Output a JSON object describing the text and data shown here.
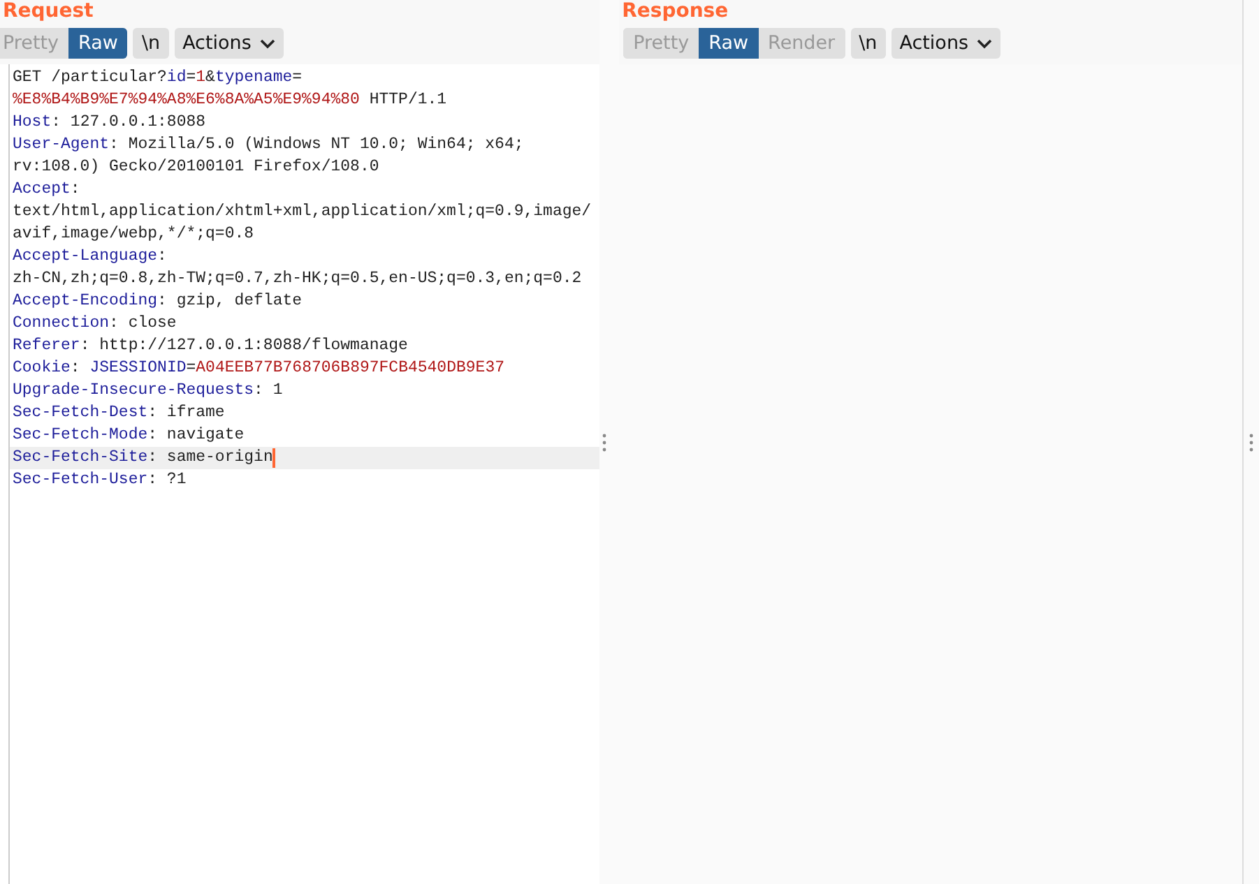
{
  "panels": [
    {
      "title": "Request",
      "view_modes": [
        {
          "label": "Pretty",
          "selected": false
        },
        {
          "label": "Raw",
          "selected": true
        }
      ],
      "newline_button": "\\n",
      "actions_button": "Actions",
      "lines": [
        {
          "highlighted": false,
          "segments": [
            {
              "kind": "plain",
              "text": "GET /particular?"
            },
            {
              "kind": "key",
              "text": "id"
            },
            {
              "kind": "plain",
              "text": "="
            },
            {
              "kind": "value",
              "text": "1"
            },
            {
              "kind": "plain",
              "text": "&"
            },
            {
              "kind": "key",
              "text": "typename"
            },
            {
              "kind": "plain",
              "text": "="
            }
          ]
        },
        {
          "highlighted": false,
          "segments": [
            {
              "kind": "value",
              "text": "%E8%B4%B9%E7%94%A8%E6%8A%A5%E9%94%80"
            },
            {
              "kind": "plain",
              "text": " HTTP/1.1"
            }
          ]
        },
        {
          "highlighted": false,
          "segments": [
            {
              "kind": "key",
              "text": "Host"
            },
            {
              "kind": "plain",
              "text": ": 127.0.0.1:8088"
            }
          ]
        },
        {
          "highlighted": false,
          "segments": [
            {
              "kind": "key",
              "text": "User-Agent"
            },
            {
              "kind": "plain",
              "text": ": Mozilla/5.0 (Windows NT 10.0; Win64; x64;"
            }
          ]
        },
        {
          "highlighted": false,
          "segments": [
            {
              "kind": "plain",
              "text": "rv:108.0) Gecko/20100101 Firefox/108.0"
            }
          ]
        },
        {
          "highlighted": false,
          "segments": [
            {
              "kind": "key",
              "text": "Accept"
            },
            {
              "kind": "plain",
              "text": ":"
            }
          ]
        },
        {
          "highlighted": false,
          "segments": [
            {
              "kind": "plain",
              "text": "text/html,application/xhtml+xml,application/xml;q=0.9,image/"
            }
          ]
        },
        {
          "highlighted": false,
          "segments": [
            {
              "kind": "plain",
              "text": "avif,image/webp,*/*;q=0.8"
            }
          ]
        },
        {
          "highlighted": false,
          "segments": [
            {
              "kind": "key",
              "text": "Accept-Language"
            },
            {
              "kind": "plain",
              "text": ":"
            }
          ]
        },
        {
          "highlighted": false,
          "segments": [
            {
              "kind": "plain",
              "text": "zh-CN,zh;q=0.8,zh-TW;q=0.7,zh-HK;q=0.5,en-US;q=0.3,en;q=0.2"
            }
          ]
        },
        {
          "highlighted": false,
          "segments": [
            {
              "kind": "key",
              "text": "Accept-Encoding"
            },
            {
              "kind": "plain",
              "text": ": gzip, deflate"
            }
          ]
        },
        {
          "highlighted": false,
          "segments": [
            {
              "kind": "key",
              "text": "Connection"
            },
            {
              "kind": "plain",
              "text": ": close"
            }
          ]
        },
        {
          "highlighted": false,
          "segments": [
            {
              "kind": "key",
              "text": "Referer"
            },
            {
              "kind": "plain",
              "text": ": http://127.0.0.1:8088/flowmanage"
            }
          ]
        },
        {
          "highlighted": false,
          "segments": [
            {
              "kind": "key",
              "text": "Cookie"
            },
            {
              "kind": "plain",
              "text": ": "
            },
            {
              "kind": "key",
              "text": "JSESSIONID"
            },
            {
              "kind": "plain",
              "text": "="
            },
            {
              "kind": "value",
              "text": "A04EEB77B768706B897FCB4540DB9E37"
            }
          ]
        },
        {
          "highlighted": false,
          "segments": [
            {
              "kind": "key",
              "text": "Upgrade-Insecure-Requests"
            },
            {
              "kind": "plain",
              "text": ": 1"
            }
          ]
        },
        {
          "highlighted": false,
          "segments": [
            {
              "kind": "key",
              "text": "Sec-Fetch-Dest"
            },
            {
              "kind": "plain",
              "text": ": iframe"
            }
          ]
        },
        {
          "highlighted": false,
          "segments": [
            {
              "kind": "key",
              "text": "Sec-Fetch-Mode"
            },
            {
              "kind": "plain",
              "text": ": navigate"
            }
          ]
        },
        {
          "highlighted": true,
          "segments": [
            {
              "kind": "key",
              "text": "Sec-Fetch-Site"
            },
            {
              "kind": "plain",
              "text": ": same-origin"
            }
          ]
        },
        {
          "highlighted": false,
          "segments": [
            {
              "kind": "key",
              "text": "Sec-Fetch-User"
            },
            {
              "kind": "plain",
              "text": ": ?1"
            }
          ]
        }
      ]
    },
    {
      "title": "Response",
      "view_modes": [
        {
          "label": "Pretty",
          "selected": false
        },
        {
          "label": "Raw",
          "selected": true
        },
        {
          "label": "Render",
          "selected": false
        }
      ],
      "newline_button": "\\n",
      "actions_button": "Actions"
    }
  ]
}
